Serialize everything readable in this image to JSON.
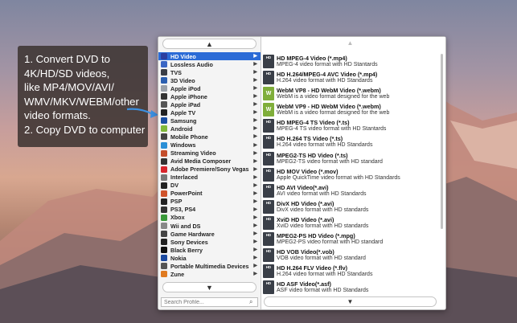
{
  "caption": {
    "lines": [
      "1. Convert DVD to",
      "4K/HD/SD videos,",
      "like MP4/MOV/AVI/",
      "WMV/MKV/WEBM/other",
      "video formats.",
      "2. Copy DVD to computer"
    ]
  },
  "profile_panel": {
    "categories": [
      {
        "label": "HD Video",
        "icon": "hd-icon",
        "color": "#2c3e9e",
        "selected": true
      },
      {
        "label": "Lossless Audio",
        "icon": "music-icon",
        "color": "#3a66c4"
      },
      {
        "label": "TVS",
        "icon": "tv-icon",
        "color": "#3b3f47"
      },
      {
        "label": "3D Video",
        "icon": "3d-icon",
        "color": "#2b5fb0"
      },
      {
        "label": "Apple iPod",
        "icon": "ipod-icon",
        "color": "#9aa0a8"
      },
      {
        "label": "Apple iPhone",
        "icon": "iphone-icon",
        "color": "#333"
      },
      {
        "label": "Apple iPad",
        "icon": "ipad-icon",
        "color": "#555"
      },
      {
        "label": "Apple TV",
        "icon": "apple-tv-icon",
        "color": "#222"
      },
      {
        "label": "Samsung",
        "icon": "samsung-icon",
        "color": "#1a4fa3"
      },
      {
        "label": "Android",
        "icon": "android-icon",
        "color": "#7fb83a"
      },
      {
        "label": "Mobile Phone",
        "icon": "phone-icon",
        "color": "#444"
      },
      {
        "label": "Windows",
        "icon": "windows-icon",
        "color": "#2a8fd6"
      },
      {
        "label": "Streaming Video",
        "icon": "streaming-icon",
        "color": "#c44d2b"
      },
      {
        "label": "Avid Media Composer",
        "icon": "avid-icon",
        "color": "#333"
      },
      {
        "label": "Adobe Premiere/Sony Vegas",
        "icon": "adobe-icon",
        "color": "#d8242b"
      },
      {
        "label": "Interlaced",
        "icon": "interlaced-icon",
        "color": "#777"
      },
      {
        "label": "DV",
        "icon": "dv-icon",
        "color": "#222"
      },
      {
        "label": "PowerPoint",
        "icon": "powerpoint-icon",
        "color": "#d0532b"
      },
      {
        "label": "PSP",
        "icon": "psp-icon",
        "color": "#222"
      },
      {
        "label": "PS3, PS4",
        "icon": "playstation-icon",
        "color": "#333"
      },
      {
        "label": "Xbox",
        "icon": "xbox-icon",
        "color": "#3a9a3a"
      },
      {
        "label": "Wii and DS",
        "icon": "wii-icon",
        "color": "#888"
      },
      {
        "label": "Game Hardware",
        "icon": "gamepad-icon",
        "color": "#444"
      },
      {
        "label": "Sony Devices",
        "icon": "sony-icon",
        "color": "#222"
      },
      {
        "label": "Black Berry",
        "icon": "blackberry-icon",
        "color": "#111"
      },
      {
        "label": "Nokia",
        "icon": "nokia-icon",
        "color": "#1c4aa0"
      },
      {
        "label": "Portable Multimedia Devices",
        "icon": "media-player-icon",
        "color": "#555"
      },
      {
        "label": "Zune",
        "icon": "zune-icon",
        "color": "#e07a20"
      }
    ],
    "search_placeholder": "Search Profile...",
    "formats": [
      {
        "title": "HD MPEG-4 Video (*.mp4)",
        "desc": "MPEG-4 video format with HD Stantards",
        "badge": "HD"
      },
      {
        "title": "HD H.264/MPEG-4 AVC Video (*.mp4)",
        "desc": "H.264 video format with HD Standards",
        "badge": "HD"
      },
      {
        "title": "WebM VP8 - HD WebM Video (*.webm)",
        "desc": "WebM is a video format designed for the web",
        "badge": "W"
      },
      {
        "title": "WebM VP9 - HD WebM Video (*.webm)",
        "desc": "WebM is a video format designed for the web",
        "badge": "W"
      },
      {
        "title": "HD MPEG-4 TS Video (*.ts)",
        "desc": "MPEG-4 TS video format with HD Stantards",
        "badge": "HD"
      },
      {
        "title": "HD H.264 TS Video (*.ts)",
        "desc": "H.264 video format with HD Standards",
        "badge": "HD"
      },
      {
        "title": "MPEG2-TS HD Video (*.ts)",
        "desc": "MPEG2-TS video format with HD standard",
        "badge": "HD"
      },
      {
        "title": "HD MOV Video (*.mov)",
        "desc": "Apple QuickTime video format with HD Standards",
        "badge": "HD"
      },
      {
        "title": "HD AVI Video(*.avi)",
        "desc": "AVI video format with HD Standards",
        "badge": "HD"
      },
      {
        "title": "DivX HD Video (*.avi)",
        "desc": "DivX video format with HD standards",
        "badge": "HD"
      },
      {
        "title": "XviD HD Video (*.avi)",
        "desc": "XviD video format with HD standards",
        "badge": "HD"
      },
      {
        "title": "MPEG2-PS HD Video (*.mpg)",
        "desc": "MPEG2-PS video format with HD standard",
        "badge": "HD"
      },
      {
        "title": "HD VOB Video(*.vob)",
        "desc": "VOB video format with HD standard",
        "badge": "HD"
      },
      {
        "title": "HD H.264 FLV Video (*.flv)",
        "desc": "H.264 video format with HD Standards",
        "badge": "HD"
      },
      {
        "title": "HD ASF Video(*.asf)",
        "desc": "ASF video format with HD Standards",
        "badge": "HD"
      }
    ]
  }
}
